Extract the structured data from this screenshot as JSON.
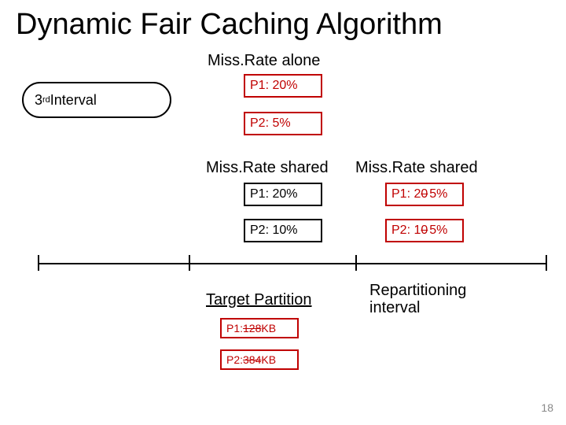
{
  "title": "Dynamic Fair Caching Algorithm",
  "interval_label_pre": "3",
  "interval_label_sup": "rd",
  "interval_label_post": " Interval",
  "headings": {
    "alone": "Miss.Rate alone",
    "shared1": "Miss.Rate shared",
    "shared2": "Miss.Rate shared",
    "target": "Target Partition",
    "repart_l1": "Repartitioning",
    "repart_l2": "interval"
  },
  "alone": {
    "p1": "P1: 20%",
    "p2": "P2: 5%"
  },
  "shared1": {
    "p1": "P1: 20%",
    "p2": "P2: 10%"
  },
  "shared2": {
    "p1_label": "P1: 2",
    "p1_strike": "0",
    "p1_after": "5%",
    "p2_label": "P2: 1",
    "p2_strike": "0",
    "p2_after": "5%"
  },
  "target": {
    "p1_label": "P1: ",
    "p1_strike": "128",
    "p1_after": "KB",
    "p2_label": "P2: ",
    "p2_strike": "384",
    "p2_after": "KB"
  },
  "page": "18"
}
